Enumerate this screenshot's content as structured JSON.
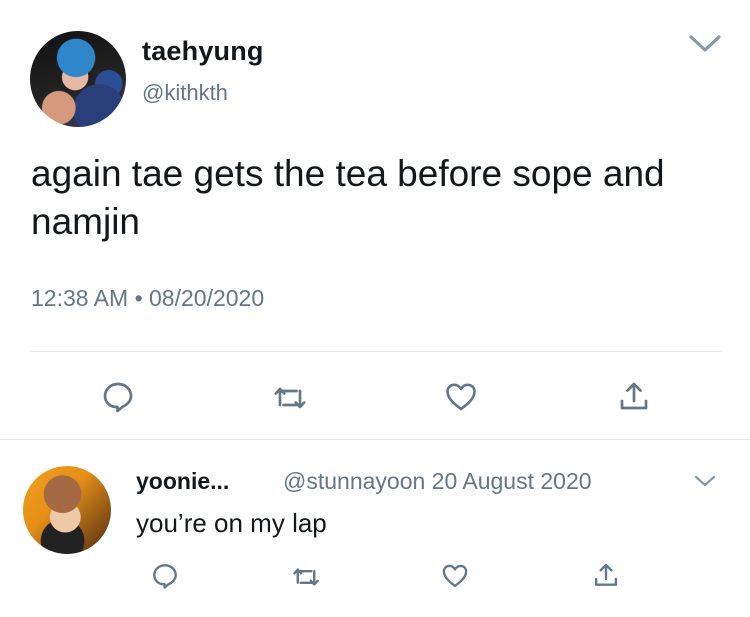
{
  "tweet": {
    "display_name": "taehyung",
    "handle": "@kithkth",
    "text": "again tae gets the tea before sope and namjin",
    "timestamp": "12:38 AM • 08/20/2020"
  },
  "reply": {
    "display_name": "yoonie...",
    "handle": "@stunnayoon",
    "date": "20 August 2020",
    "handle_date": "@stunnayoon 20 August 2020",
    "text": "you’re on my lap"
  },
  "icons": {
    "reply": "reply-icon",
    "retweet": "retweet-icon",
    "like": "heart-icon",
    "share": "share-icon",
    "more": "chevron-down-icon"
  },
  "colors": {
    "primary_text": "#14171a",
    "secondary_text": "#657786",
    "divider": "#e1e8ed",
    "icon": "#657786"
  }
}
